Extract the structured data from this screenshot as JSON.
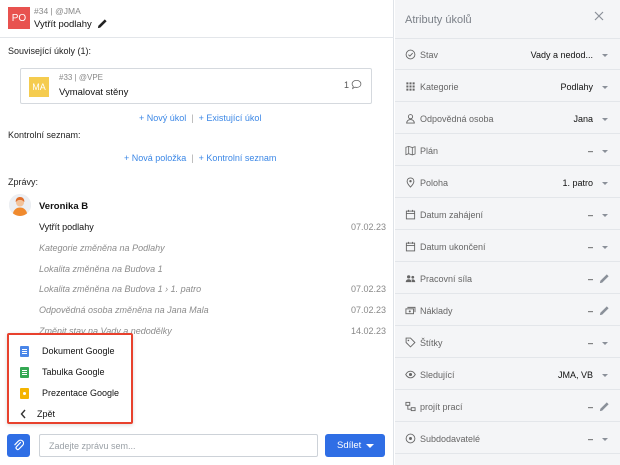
{
  "task": {
    "badge": "PO",
    "id_line": "#34 | @JMA",
    "title": "Vytřít podlahy",
    "badge_color": "#e8524f"
  },
  "related": {
    "label": "Související úkoly (1):",
    "card": {
      "avatar": "MA",
      "avatar_color": "#f5cc4f",
      "id_line": "#33 | @VPE",
      "title": "Vymalovat stěny",
      "comment_count": "1"
    },
    "links": [
      "+ Nový úkol",
      "+ Existující úkol"
    ]
  },
  "checklist": {
    "label": "Kontrolní seznam:",
    "links": [
      "+ Nová položka",
      "+ Kontrolní seznam"
    ]
  },
  "messages": {
    "label": "Zprávy:",
    "author": "Veronika B",
    "items": [
      {
        "text": "Vytřít podlahy",
        "date": "07.02.23",
        "kind": "main"
      },
      {
        "text": "Kategorie změněna na Podlahy",
        "date": "",
        "kind": "log"
      },
      {
        "text": "Lokalita změněna na Budova 1",
        "date": "",
        "kind": "log"
      },
      {
        "text": "Lokalita změněna na Budova 1 › 1. patro",
        "date": "07.02.23",
        "kind": "log"
      },
      {
        "text": "Odpovědná osoba změněna na Jana Mala",
        "date": "07.02.23",
        "kind": "log"
      },
      {
        "text": "Změnit stav na Vady a nedodělky",
        "date": "14.02.23",
        "kind": "log"
      }
    ]
  },
  "attach_menu": {
    "items": [
      {
        "label": "Dokument Google",
        "icon": "google-docs-icon"
      },
      {
        "label": "Tabulka Google",
        "icon": "google-sheets-icon"
      },
      {
        "label": "Prezentace Google",
        "icon": "google-slides-icon"
      }
    ],
    "back": "Zpět",
    "highlight_color": "#e8412d"
  },
  "composer": {
    "placeholder": "Zadejte zprávu sem...",
    "share": "Sdílet",
    "accent": "#2f6ee5"
  },
  "attributes": {
    "title": "Atributy úkolů",
    "rows": [
      {
        "label": "Stav",
        "value": "Vady a nedod...",
        "icon": "check-circle-icon",
        "control": "dropdown"
      },
      {
        "label": "Kategorie",
        "value": "Podlahy",
        "icon": "grid-icon",
        "control": "dropdown"
      },
      {
        "label": "Odpovědná osoba",
        "value": "Jana",
        "icon": "person-icon",
        "control": "dropdown"
      },
      {
        "label": "Plán",
        "value": "–",
        "icon": "map-icon",
        "control": "dropdown"
      },
      {
        "label": "Poloha",
        "value": "1. patro",
        "icon": "location-pin-icon",
        "control": "dropdown"
      },
      {
        "label": "Datum zahájení",
        "value": "–",
        "icon": "calendar-icon",
        "control": "dropdown"
      },
      {
        "label": "Datum ukončení",
        "value": "–",
        "icon": "calendar-icon",
        "control": "dropdown"
      },
      {
        "label": "Pracovní síla",
        "value": "–",
        "icon": "people-icon",
        "control": "edit"
      },
      {
        "label": "Náklady",
        "value": "–",
        "icon": "money-icon",
        "control": "edit"
      },
      {
        "label": "Štítky",
        "value": "–",
        "icon": "tag-icon",
        "control": "dropdown"
      },
      {
        "label": "Sledující",
        "value": "JMA, VB",
        "icon": "eye-icon",
        "control": "dropdown"
      },
      {
        "label": "projít prací",
        "value": "–",
        "icon": "workflow-icon",
        "control": "edit"
      },
      {
        "label": "Subdodavatelé",
        "value": "–",
        "icon": "subcontractor-icon",
        "control": "dropdown"
      }
    ]
  }
}
